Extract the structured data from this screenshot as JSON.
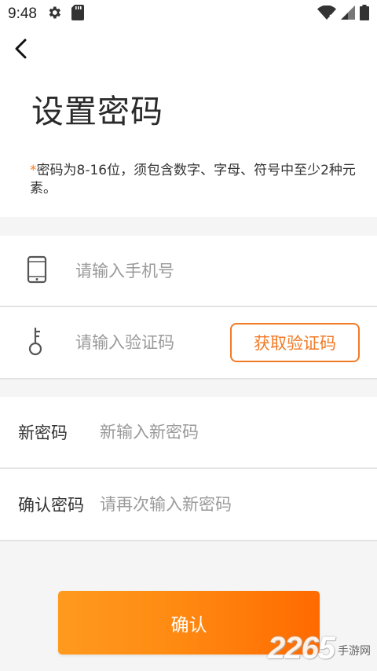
{
  "status_bar": {
    "time": "9:48",
    "icons": [
      "settings-icon",
      "sd-card-icon",
      "wifi-icon",
      "signal-icon",
      "battery-icon"
    ]
  },
  "header": {
    "back_icon": "chevron-left-icon",
    "title": "设置密码"
  },
  "hint": {
    "star": "*",
    "text": "密码为8-16位，须包含数字、字母、符号中至少2种元素。"
  },
  "form": {
    "phone": {
      "icon": "phone-icon",
      "placeholder": "请输入手机号"
    },
    "code": {
      "icon": "key-icon",
      "placeholder": "请输入验证码",
      "button_label": "获取验证码"
    },
    "new_password": {
      "label": "新密码",
      "placeholder": "新输入新密码"
    },
    "confirm_password": {
      "label": "确认密码",
      "placeholder": "请再次输入新密码"
    }
  },
  "confirm_button": {
    "label": "确认"
  },
  "watermark": {
    "number": "2265",
    "text": "手游网"
  },
  "colors": {
    "accent": "#f27a25",
    "button_gradient_start": "#ff9a1e",
    "button_gradient_end": "#ff6a00",
    "band": "#f5f5f5",
    "divider": "#e3e3e3"
  }
}
